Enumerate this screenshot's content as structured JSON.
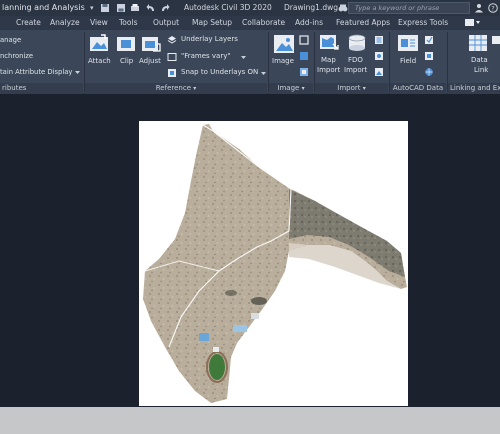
{
  "titlebar": {
    "workspace": "lanning and Analysis",
    "app_title": "Autodesk Civil 3D 2020",
    "document": "Drawing1.dwg",
    "search_placeholder": "Type a keyword or phrase"
  },
  "tabs": [
    {
      "label": "Create"
    },
    {
      "label": "Analyze"
    },
    {
      "label": "View"
    },
    {
      "label": "Tools"
    },
    {
      "label": "Output"
    },
    {
      "label": "Map Setup"
    },
    {
      "label": "Collaborate"
    },
    {
      "label": "Add-ins"
    },
    {
      "label": "Featured Apps"
    },
    {
      "label": "Express Tools"
    }
  ],
  "ribbon": {
    "left_items": {
      "manage": "anage",
      "synchronize": "nchronize",
      "maintain": "tain Attribute Display",
      "panel": "ributes"
    },
    "reference": {
      "attach": "Attach",
      "clip": "Clip",
      "adjust": "Adjust",
      "underlay_layers": "Underlay Layers",
      "frames_vary": "\"Frames vary\"",
      "snap_to_underlays": "Snap to Underlays ON",
      "panel": "Reference"
    },
    "image": {
      "image": "Image",
      "panel": "Image"
    },
    "import": {
      "map_import_line1": "Map",
      "map_import_line2": "Import",
      "fdo_import_line1": "FDO",
      "fdo_import_line2": "Import",
      "panel": "Import"
    },
    "autocad_data": {
      "field": "Field",
      "panel": "AutoCAD Data"
    },
    "linking": {
      "data_link_line1": "Data",
      "data_link_line2": "Link",
      "panel": "Linking and Extr"
    }
  },
  "colors": {
    "titlebar": "#2b3442",
    "tabbar": "#2e3848",
    "ribbon": "#3b4658",
    "canvas": "#1b222e",
    "sheet": "#ffffff",
    "icon_blue": "#4a90d9"
  }
}
